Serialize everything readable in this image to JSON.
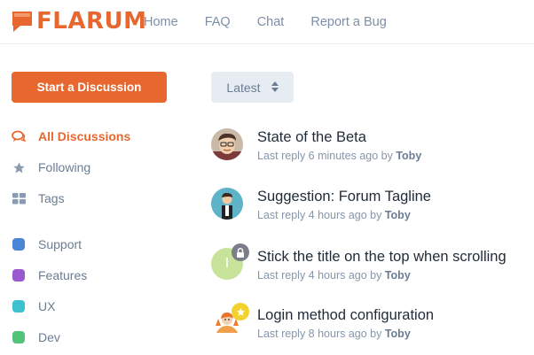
{
  "header": {
    "logo_text": "FLARUM",
    "nav": [
      "Home",
      "FAQ",
      "Chat",
      "Report a Bug"
    ]
  },
  "sidebar": {
    "start_label": "Start a Discussion",
    "items": [
      {
        "label": "All Discussions",
        "icon": "comments-icon",
        "active": true
      },
      {
        "label": "Following",
        "icon": "star-icon"
      },
      {
        "label": "Tags",
        "icon": "tags-grid-icon"
      }
    ],
    "tags": [
      {
        "label": "Support",
        "color": "#4b86d6"
      },
      {
        "label": "Features",
        "color": "#9b59d0"
      },
      {
        "label": "UX",
        "color": "#3cc2cf"
      },
      {
        "label": "Dev",
        "color": "#52c47a"
      }
    ]
  },
  "main": {
    "sort_label": "Latest",
    "discussions": [
      {
        "title": "State of the Beta",
        "meta": "Last reply 6 minutes ago by ",
        "user": "Toby"
      },
      {
        "title": "Suggestion: Forum Tagline",
        "meta": "Last reply 4 hours ago by ",
        "user": "Toby"
      },
      {
        "title": "Stick the title on the top when scrolling",
        "meta": "Last reply 4 hours ago by ",
        "user": "Toby",
        "avatar_letter": "I",
        "badge": "lock-icon"
      },
      {
        "title": "Login method configuration",
        "meta": "Last reply 8 hours ago by ",
        "user": "Toby",
        "badge": "star-icon"
      }
    ]
  },
  "colors": {
    "brand": "#e7672e",
    "muted": "#6b7d93"
  }
}
